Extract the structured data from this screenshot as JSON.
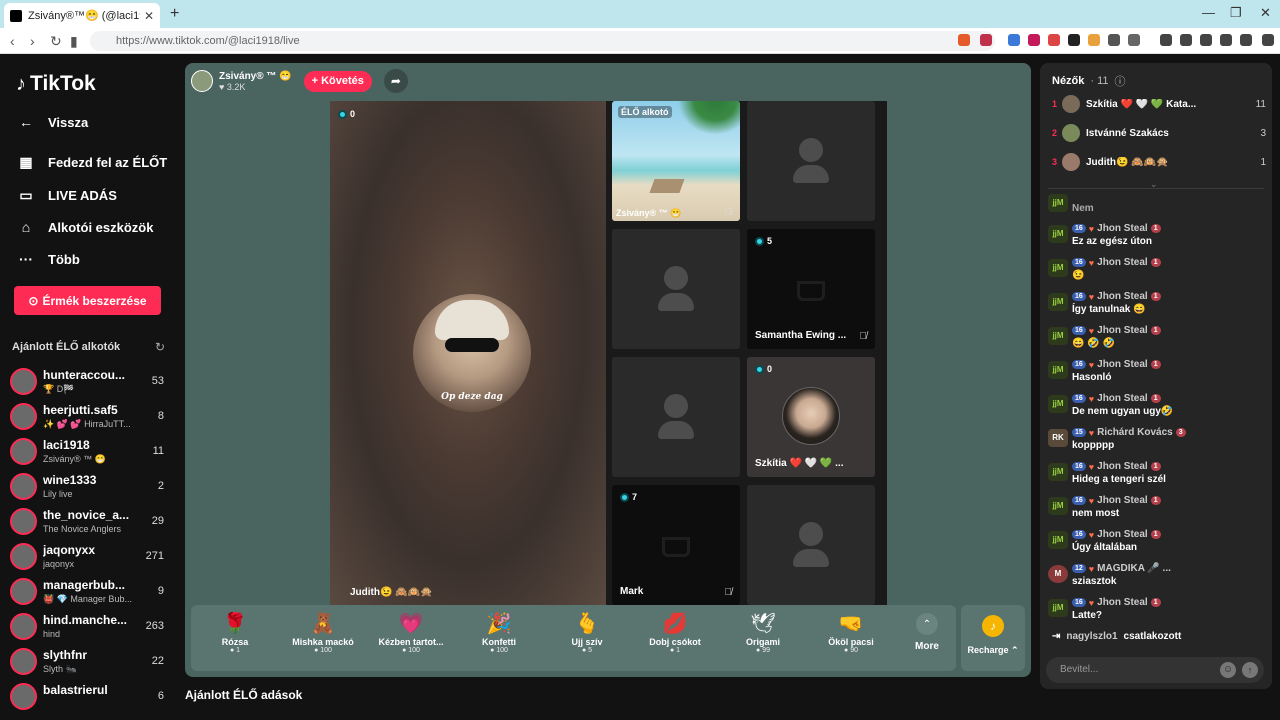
{
  "browser": {
    "tab_title": "Zsivány®™😁 (@laci1918) É...",
    "url": "https://www.tiktok.com/@laci1918/live"
  },
  "sidebar": {
    "logo": "TikTok",
    "nav": [
      {
        "label": "Vissza",
        "icon": "back-arrow-icon"
      },
      {
        "label": "Fedezd fel az ÉLŐT",
        "icon": "calendar-icon"
      },
      {
        "label": "LIVE ADÁS",
        "icon": "video-camera-icon"
      },
      {
        "label": "Alkotói eszközök",
        "icon": "home-tools-icon"
      },
      {
        "label": "Több",
        "icon": "more-dots-icon"
      }
    ],
    "coin_button": "Érmék beszerzése",
    "suggested_title": "Ajánlott ÉLŐ alkotók",
    "creators": [
      {
        "name": "hunteraccou...",
        "sub": "🏆 D🏁",
        "count": "53"
      },
      {
        "name": "heerjutti.saf5",
        "sub": "✨ 💕 💕 HirraJuTT...",
        "count": "8"
      },
      {
        "name": "laci1918",
        "sub": "Zsivány® ™ 😁",
        "count": "11"
      },
      {
        "name": "wine1333",
        "sub": "Lily live",
        "count": "2"
      },
      {
        "name": "the_novice_a...",
        "sub": "The Novice Anglers",
        "count": "29"
      },
      {
        "name": "jaqonyxx",
        "sub": "jaqonyx",
        "count": "271"
      },
      {
        "name": "managerbub...",
        "sub": "👹 💎 Manager Bub...",
        "count": "9"
      },
      {
        "name": "hind.manche...",
        "sub": "hind",
        "count": "263"
      },
      {
        "name": "slythfnr",
        "sub": "Slyth 🐜",
        "count": "22"
      },
      {
        "name": "balastrierul",
        "sub": "",
        "count": "6"
      }
    ]
  },
  "stream": {
    "host_name": "Zsivány® ™ 😁",
    "host_likes": "♥ 3.2K",
    "follow_label": "+ Követés",
    "main_guest": {
      "name": "Judith😉 🙈🙉🙊",
      "count": "0",
      "caption": "Op deze dag"
    },
    "tiles": [
      {
        "name": "Zsivány® ™ 😁",
        "badge": "ÉLŐ alkotó",
        "type": "beach"
      },
      {
        "name": "",
        "type": "empty"
      },
      {
        "name": "",
        "type": "empty"
      },
      {
        "name": "Samantha Ewing ...",
        "count": "5",
        "type": "cup"
      },
      {
        "name": "",
        "type": "empty"
      },
      {
        "name": "Szkítia ❤️ 🤍 💚 ...",
        "count": "0",
        "type": "woman"
      },
      {
        "name": "Mark",
        "count": "7",
        "type": "cup"
      },
      {
        "name": "",
        "type": "empty"
      }
    ],
    "gifts": [
      {
        "name": "Rózsa",
        "price": "1",
        "icon": "🌹"
      },
      {
        "name": "Mishka mackó",
        "price": "100",
        "icon": "🧸"
      },
      {
        "name": "Kézben tartot...",
        "price": "100",
        "icon": "💗"
      },
      {
        "name": "Konfetti",
        "price": "100",
        "icon": "🎉"
      },
      {
        "name": "Ujj szív",
        "price": "5",
        "icon": "🫰"
      },
      {
        "name": "Dobj csókot",
        "price": "1",
        "icon": "💋"
      },
      {
        "name": "Origami",
        "price": "99",
        "icon": "🕊"
      },
      {
        "name": "Ököl pacsi",
        "price": "90",
        "icon": "🤜"
      }
    ],
    "more_label": "More",
    "recharge_label": "Recharge ⌃",
    "recommended_title": "Ajánlott ÉLŐ adások"
  },
  "chat": {
    "title": "Nézők",
    "viewer_count": "· 11",
    "viewers": [
      {
        "rank": "1",
        "name": "Szkítia ❤️ 🤍 💚 Kata...",
        "score": "11"
      },
      {
        "rank": "2",
        "name": "Istvánné Szakács",
        "score": "3"
      },
      {
        "rank": "3",
        "name": "Judith😉 🙈🙉🙊",
        "score": "1"
      }
    ],
    "partial": "Nem",
    "messages": [
      {
        "lvl": "16",
        "user": "Jhon Steal",
        "fan": "1",
        "text": "Ez az egész úton"
      },
      {
        "lvl": "16",
        "user": "Jhon Steal",
        "fan": "1",
        "text": "😉"
      },
      {
        "lvl": "16",
        "user": "Jhon Steal",
        "fan": "1",
        "text": "Így tanulnak 😄"
      },
      {
        "lvl": "16",
        "user": "Jhon Steal",
        "fan": "1",
        "text": "😄 🤣 🤣"
      },
      {
        "lvl": "16",
        "user": "Jhon Steal",
        "fan": "1",
        "text": "Hasonló"
      },
      {
        "lvl": "16",
        "user": "Jhon Steal",
        "fan": "1",
        "text": "De nem ugyan ugy🤣"
      },
      {
        "lvl": "15",
        "user": "Richárd Kovács",
        "fan": "3",
        "text": "koppppp"
      },
      {
        "lvl": "16",
        "user": "Jhon Steal",
        "fan": "1",
        "text": "Hideg a tengeri szél"
      },
      {
        "lvl": "16",
        "user": "Jhon Steal",
        "fan": "1",
        "text": "nem most"
      },
      {
        "lvl": "16",
        "user": "Jhon Steal",
        "fan": "1",
        "text": "Úgy általában"
      },
      {
        "lvl": "12",
        "user": "MAGDIKA 🎤 ...",
        "fan": "",
        "text": "sziasztok"
      },
      {
        "lvl": "16",
        "user": "Jhon Steal",
        "fan": "1",
        "text": "Latte?"
      }
    ],
    "joined_user": "nagylszlo1",
    "joined_text": "csatlakozott",
    "input_placeholder": "Bevitel..."
  }
}
